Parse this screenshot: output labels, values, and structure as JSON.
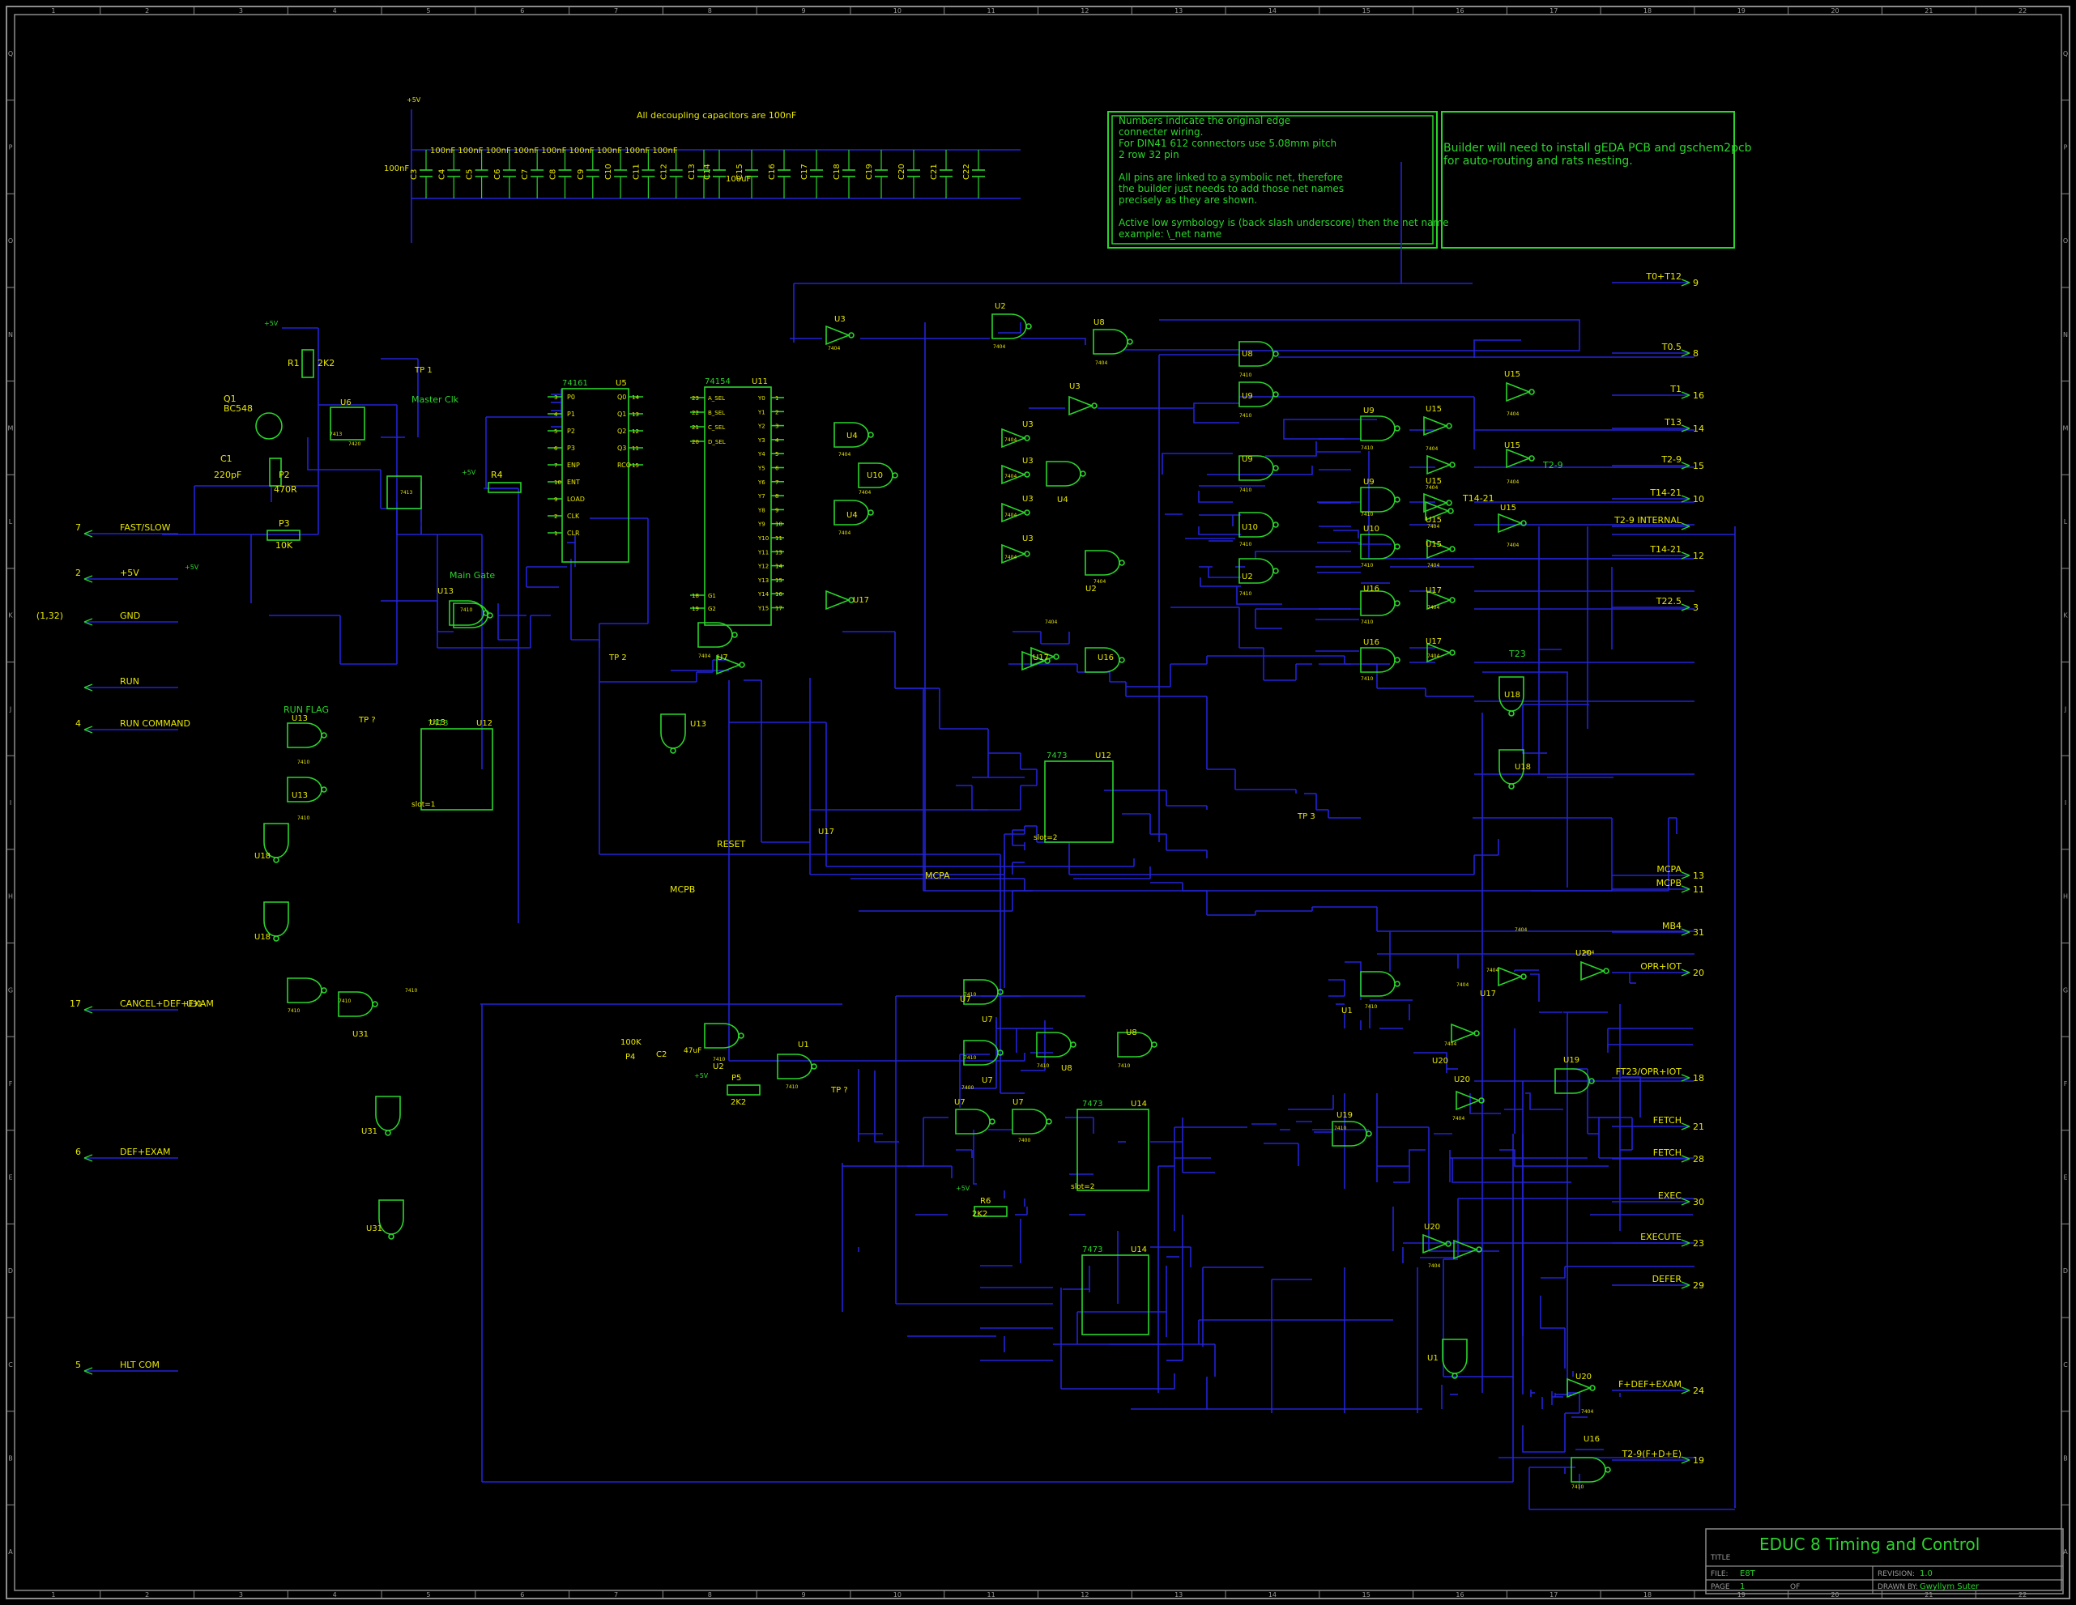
{
  "frame": {
    "columns": [
      "1",
      "2",
      "3",
      "4",
      "5",
      "6",
      "7",
      "8",
      "9",
      "10",
      "11",
      "12",
      "13",
      "14",
      "15",
      "16",
      "17",
      "18",
      "19",
      "20",
      "21",
      "22"
    ],
    "rows": [
      "Q",
      "P",
      "O",
      "N",
      "M",
      "L",
      "K",
      "J",
      "I",
      "H",
      "G",
      "F",
      "E",
      "D",
      "C",
      "B",
      "A"
    ]
  },
  "notes": {
    "decoupling": "All decoupling capacitors are 100nF",
    "edge_note": [
      "Numbers indicate the original edge",
      "connecter wiring.",
      "For DIN41 612 connectors use 5.08mm pitch",
      "2 row 32 pin",
      "",
      "All pins are linked to a symbolic net, therefore",
      "the builder just needs to add those net names",
      "precisely as they are shown.",
      "",
      "Active low symbology is (back slash  underscore) then the net name",
      "example: \\_net name"
    ],
    "builder_note": [
      "Builder will need to install gEDA PCB and gschem2pcb",
      "for auto-routing and rats nesting."
    ]
  },
  "caps": {
    "top_values": [
      "100nF",
      "100nF",
      "100nF",
      "100nF",
      "100nF",
      "100nF",
      "100nF",
      "100nF",
      "100nF"
    ],
    "labels": [
      "C3",
      "C4",
      "C5",
      "C6",
      "C7",
      "C8",
      "C9",
      "C10",
      "C11",
      "C12",
      "C13",
      "C14",
      "C15",
      "C16",
      "C17",
      "C18",
      "C19",
      "C20",
      "C21",
      "C22"
    ],
    "c3_value": "100nF",
    "big_value": "100uF",
    "supply": "+5V"
  },
  "left_ports": [
    {
      "pin": "7",
      "name": "FAST/SLOW"
    },
    {
      "pin": "2",
      "name": "+5V"
    },
    {
      "pin": "(1,32)",
      "name": "GND"
    },
    {
      "pin": "",
      "name": "RUN"
    },
    {
      "pin": "4",
      "name": "RUN COMMAND"
    },
    {
      "pin": "17",
      "name": "CANCEL+DEF+EXAM"
    },
    {
      "pin": "6",
      "name": "DEF+EXAM"
    },
    {
      "pin": "5",
      "name": "HLT COM"
    }
  ],
  "right_ports": [
    {
      "name": "T0+T12",
      "pin": "9"
    },
    {
      "name": "T0.5",
      "pin": "8"
    },
    {
      "name": "T1",
      "pin": "16"
    },
    {
      "name": "T13",
      "pin": "14"
    },
    {
      "name": "T2-9",
      "pin": "15"
    },
    {
      "name": "T14-21",
      "pin": "10"
    },
    {
      "name": "T2-9 INTERNAL",
      "pin": ""
    },
    {
      "name": "T14-21",
      "pin": "12"
    },
    {
      "name": "T22.5",
      "pin": "3"
    },
    {
      "name": "MCPA",
      "pin": "13"
    },
    {
      "name": "MCPB",
      "pin": "11"
    },
    {
      "name": "MB4",
      "pin": "31"
    },
    {
      "name": "OPR+IOT",
      "pin": "20"
    },
    {
      "name": "FT23/OPR+IOT",
      "pin": "18"
    },
    {
      "name": "FETCH",
      "pin": "21"
    },
    {
      "name": "FETCH",
      "pin": "28"
    },
    {
      "name": "EXEC",
      "pin": "30"
    },
    {
      "name": "EXECUTE",
      "pin": "23"
    },
    {
      "name": "DEFER",
      "pin": "29"
    },
    {
      "name": "F+DEF+EXAM",
      "pin": "24"
    },
    {
      "name": "T2-9(F+D+E)",
      "pin": "19"
    }
  ],
  "labels": {
    "master_clk": "Master Clk",
    "main_gate": "Main Gate",
    "run_flag": "RUN FLAG",
    "reset": "RESET",
    "mcpa": "MCPA",
    "mcpb": "MCPB",
    "t14_21": "T14-21",
    "t2_9": "T2-9",
    "tp2": "TP 2",
    "tp3": "TP 3",
    "tp": "TP ?",
    "tp1": "TP 1",
    "t23": "T23",
    "slot1": "slot=1",
    "slot2": "slot=2",
    "plus5": "+5V"
  },
  "components": {
    "q1": [
      "Q1",
      "BC548"
    ],
    "r1": [
      "R1",
      "2K2"
    ],
    "c1": [
      "C1",
      "220pF"
    ],
    "p2": [
      "P2",
      "470R"
    ],
    "p3": [
      "P3",
      "10K"
    ],
    "r4": "R4",
    "u5": {
      "ref": "U5",
      "type": "74161",
      "left_pins": [
        "P0",
        "P1",
        "P2",
        "P3",
        "ENP",
        "ENT",
        "LOAD",
        "CLK",
        "CLR"
      ],
      "right_pins": [
        "Q0",
        "Q1",
        "Q2",
        "Q3",
        "RCO"
      ],
      "left_nums": [
        "3",
        "4",
        "5",
        "6",
        "7",
        "10",
        "9",
        "2",
        "1"
      ],
      "right_nums": [
        "14",
        "13",
        "12",
        "11",
        "15"
      ]
    },
    "u11": {
      "ref": "U11",
      "type": "74154",
      "left_pins": [
        "A_SEL",
        "B_SEL",
        "C_SEL",
        "D_SEL",
        "G1",
        "G2"
      ],
      "left_nums": [
        "23",
        "22",
        "21",
        "20",
        "18",
        "19"
      ],
      "right_pins": [
        "Y0",
        "Y1",
        "Y2",
        "Y3",
        "Y4",
        "Y5",
        "Y6",
        "Y7",
        "Y8",
        "Y9",
        "Y10",
        "Y11",
        "Y12",
        "Y13",
        "Y14",
        "Y15"
      ],
      "right_nums": [
        "1",
        "2",
        "3",
        "4",
        "5",
        "6",
        "7",
        "8",
        "9",
        "10",
        "11",
        "13",
        "14",
        "15",
        "16",
        "17"
      ]
    },
    "u12": {
      "ref": "U12",
      "type": "7473"
    },
    "u14": {
      "ref": "U14",
      "type": "7473"
    },
    "p4": [
      "P4",
      "100K"
    ],
    "c2": [
      "C2",
      "47uF"
    ],
    "p5": [
      "P5",
      "2K2"
    ],
    "r6": [
      "R6",
      "2K2"
    ],
    "gate_types": [
      "7400",
      "7404",
      "7410",
      "7413",
      "7420"
    ]
  },
  "title_block": {
    "title_label": "TITLE",
    "title": "EDUC 8 Timing and Control",
    "file_label": "FILE:",
    "file": "E8T",
    "page_label": "PAGE",
    "page": "1",
    "of_label": "OF",
    "revision_label": "REVISION:",
    "revision": "1.0",
    "drawn_label": "DRAWN BY:",
    "drawn_by": "Gwyllym Suter"
  },
  "colors": {
    "background": "#000000",
    "wire": "#2222d8",
    "symbol": "#2bd52b",
    "text": "#e8e800",
    "frame": "#8c8c8c"
  }
}
